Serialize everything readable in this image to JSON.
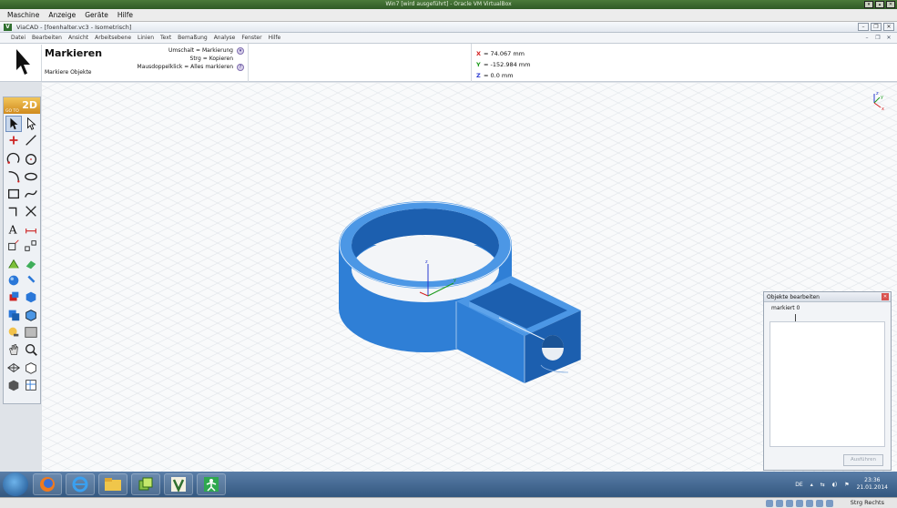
{
  "host_window": {
    "title": "Win7 [wird ausgeführt] - Oracle VM VirtualBox",
    "menu": [
      "Maschine",
      "Anzeige",
      "Geräte",
      "Hilfe"
    ],
    "status_key": "Strg Rechts"
  },
  "app": {
    "title": "ViaCAD - [foenhalter.vc3 - Isometrisch]",
    "logo": "V",
    "menu": [
      "Datei",
      "Bearbeiten",
      "Ansicht",
      "Arbeitsebene",
      "Linien",
      "Text",
      "Bemaßung",
      "Analyse",
      "Fenster",
      "Hilfe"
    ]
  },
  "infobar": {
    "tool_title": "Markieren",
    "tool_subtitle": "Markiere Objekte",
    "hints": [
      "Umschalt = Markierung",
      "Strg = Kopieren",
      "Mausdoppelklick = Alles markieren"
    ],
    "coords": [
      {
        "axis": "X",
        "value": "= 74.067 mm",
        "color": "#d42020"
      },
      {
        "axis": "Y",
        "value": "= -152.984 mm",
        "color": "#1a9a1a"
      },
      {
        "axis": "Z",
        "value": "= 0.0 mm",
        "color": "#2a3ad0"
      }
    ]
  },
  "toolbar": {
    "goto_small": "GO TO",
    "goto_big": "2D"
  },
  "viewport": {
    "model_color": "#2f7fd6",
    "model_dark": "#1c5faf",
    "model_light": "#4c97e5",
    "axes": {
      "x": "x",
      "y": "y",
      "z": "z"
    }
  },
  "panel": {
    "title": "Objekte bearbeiten",
    "label": "markiert 0",
    "button": "Ausführen"
  },
  "taskbar": {
    "lang": "DE",
    "time": "23:36",
    "date": "21.01.2014"
  }
}
